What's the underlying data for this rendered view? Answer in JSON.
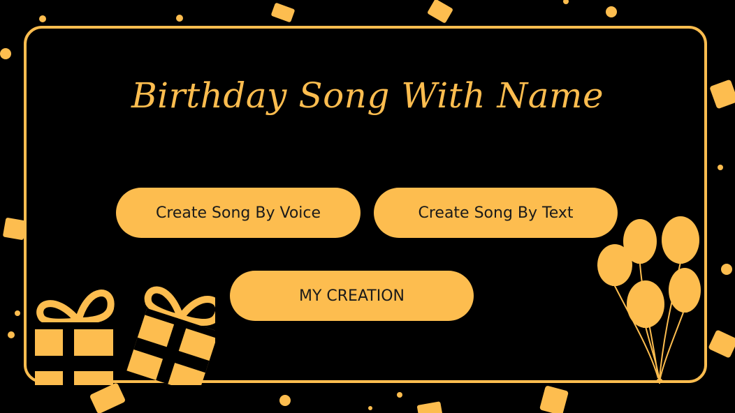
{
  "app": {
    "title": "Birthday Song With Name"
  },
  "menu": {
    "voice_label": "Create Song By Voice",
    "text_label": "Create Song By Text",
    "creation_label": "MY CREATION"
  },
  "decor": {
    "left_icon": "gift-boxes-icon",
    "right_icon": "balloons-icon",
    "background": "confetti"
  },
  "colors": {
    "accent": "#FDBD4F",
    "background": "#000000",
    "button_text": "#1a1a1a"
  }
}
